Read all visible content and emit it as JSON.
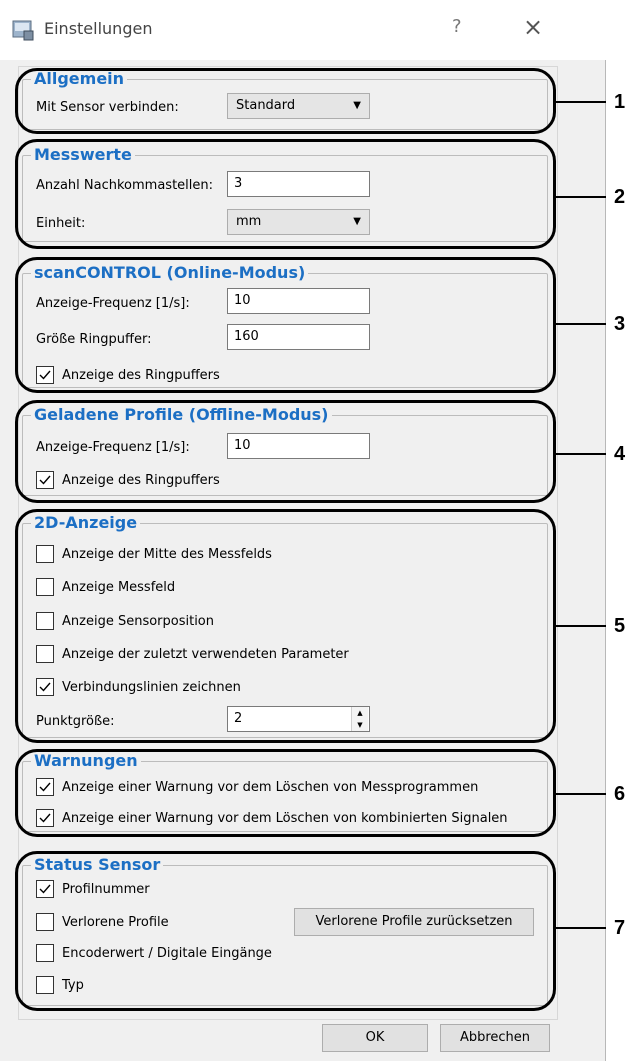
{
  "window": {
    "title": "Einstellungen",
    "help_glyph": "?",
    "close_glyph": "×"
  },
  "allgemein": {
    "title": "Allgemein",
    "connect_label": "Mit Sensor verbinden:",
    "connect_value": "Standard"
  },
  "messwerte": {
    "title": "Messwerte",
    "decimals_label": "Anzahl Nachkommastellen:",
    "decimals_value": "3",
    "unit_label": "Einheit:",
    "unit_value": "mm"
  },
  "online": {
    "title": "scanCONTROL (Online-Modus)",
    "freq_label": "Anzeige-Frequenz [1/s]:",
    "freq_value": "10",
    "buffer_label": "Größe Ringpuffer:",
    "buffer_value": "160",
    "show_buffer_label": "Anzeige des Ringpuffers",
    "show_buffer_checked": true
  },
  "offline": {
    "title": "Geladene Profile (Offline-Modus)",
    "freq_label": "Anzeige-Frequenz [1/s]:",
    "freq_value": "10",
    "show_buffer_label": "Anzeige des Ringpuffers",
    "show_buffer_checked": true
  },
  "anzeige2d": {
    "title": "2D-Anzeige",
    "options": [
      {
        "label": "Anzeige der Mitte des Messfelds",
        "checked": false
      },
      {
        "label": "Anzeige Messfeld",
        "checked": false
      },
      {
        "label": "Anzeige Sensorposition",
        "checked": false
      },
      {
        "label": "Anzeige der zuletzt verwendeten Parameter",
        "checked": false
      },
      {
        "label": "Verbindungslinien zeichnen",
        "checked": true
      }
    ],
    "point_size_label": "Punktgröße:",
    "point_size_value": "2"
  },
  "warnungen": {
    "title": "Warnungen",
    "options": [
      {
        "label": "Anzeige einer Warnung vor dem Löschen von Messprogrammen",
        "checked": true
      },
      {
        "label": "Anzeige einer Warnung vor dem Löschen von kombinierten Signalen",
        "checked": true
      }
    ]
  },
  "status": {
    "title": "Status Sensor",
    "options": [
      {
        "label": "Profilnummer",
        "checked": true
      },
      {
        "label": "Verlorene Profile",
        "checked": false
      },
      {
        "label": "Encoderwert / Digitale Eingänge",
        "checked": false
      },
      {
        "label": "Typ",
        "checked": false
      }
    ],
    "reset_button": "Verlorene Profile zurücksetzen"
  },
  "footer": {
    "ok_label": "OK",
    "cancel_label": "Abbrechen"
  },
  "callouts": [
    "1",
    "2",
    "3",
    "4",
    "5",
    "6",
    "7"
  ],
  "colors": {
    "legend": "#1c6fc4",
    "window_bg": "#f0f0f0"
  }
}
